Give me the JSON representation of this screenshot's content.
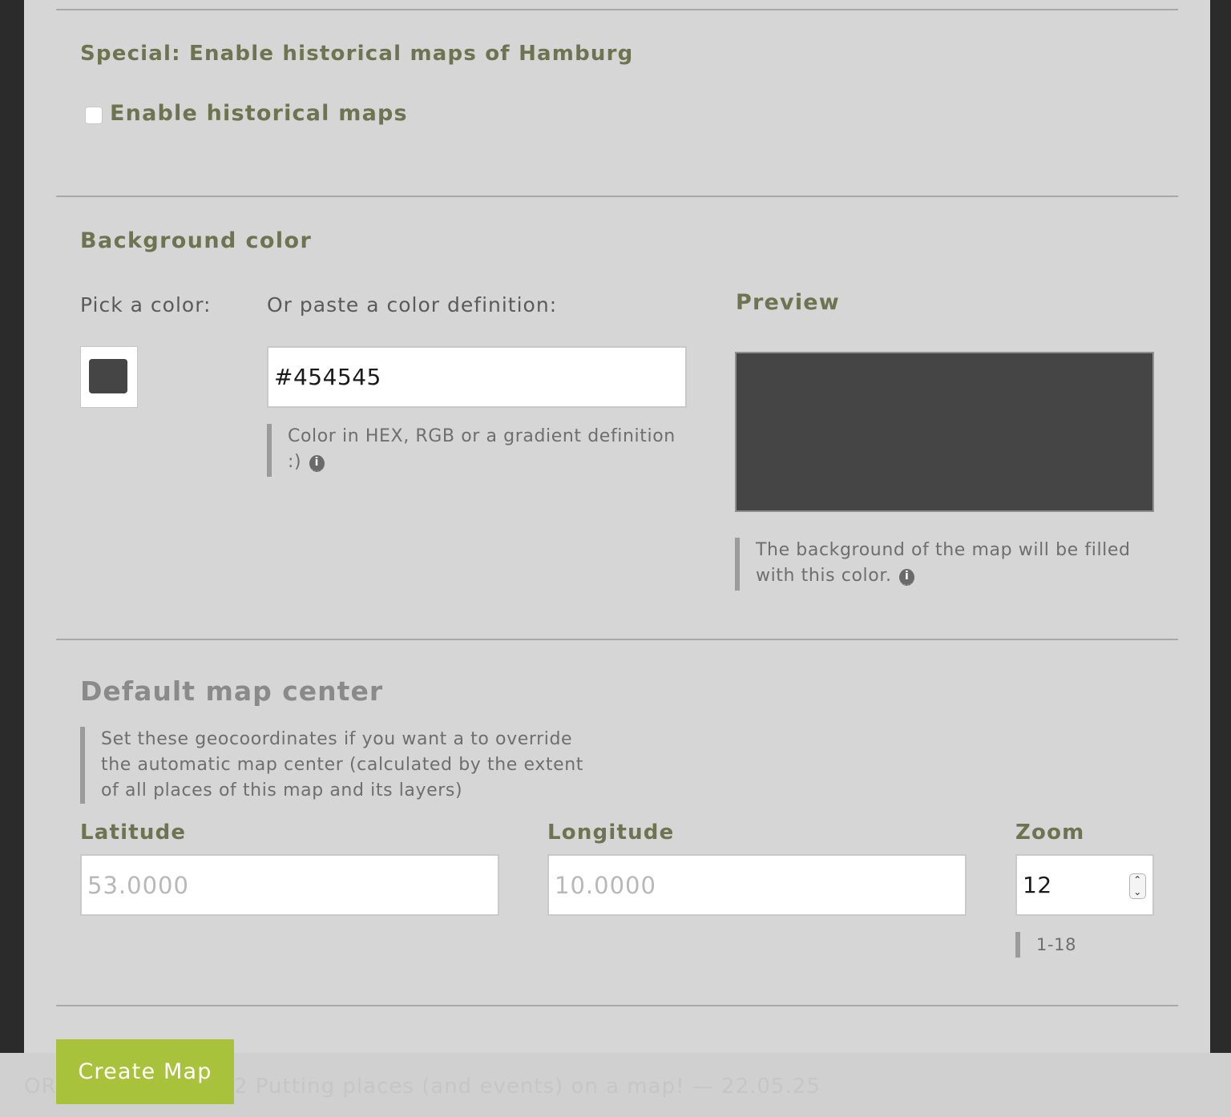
{
  "historical": {
    "heading": "Special: Enable historical maps of Hamburg",
    "checkbox_label": "Enable historical maps",
    "checked": false
  },
  "background": {
    "heading": "Background color",
    "pick_label": "Pick a color:",
    "paste_label": "Or paste a color definition:",
    "color_value": "#454545",
    "color_hint": "Color in HEX, RGB or a gradient definition :)",
    "preview_heading": "Preview",
    "preview_hint": "The background of the map will be filled with this color."
  },
  "map_center": {
    "heading": "Default map center",
    "description": "Set these geocoordinates if you want a to override the automatic map center (calculated by the extent of all places of this map and its layers)",
    "latitude_label": "Latitude",
    "latitude_placeholder": "53.0000",
    "longitude_label": "Longitude",
    "longitude_placeholder": "10.0000",
    "zoom_label": "Zoom",
    "zoom_value": "12",
    "zoom_hint": "1-18"
  },
  "actions": {
    "create_label": "Create Map"
  },
  "footer": {
    "left_text": "OR",
    "right_text": "2 Putting places (and events) on a map! — 22.05.25"
  },
  "colors": {
    "preview_fill": "#454545",
    "accent_olive": "#6e7450",
    "button_green": "#a9c23b"
  },
  "icons": {
    "info": "info-icon",
    "spinner": "stepper-arrows-icon"
  }
}
